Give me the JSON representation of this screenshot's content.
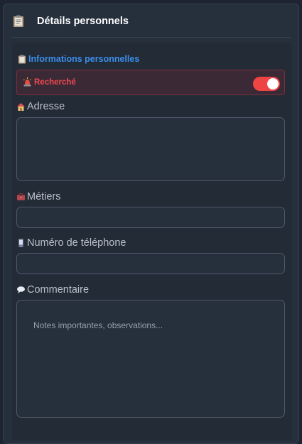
{
  "header": {
    "title": "Détails personnels",
    "icon": "clipboard-icon"
  },
  "section": {
    "title": "Informations personnelles",
    "icon": "clipboard-icon",
    "color": "#3b8eea"
  },
  "wanted": {
    "label": "Recherché",
    "icon": "siren-icon",
    "enabled": true,
    "color": "#ef4444"
  },
  "fields": {
    "address": {
      "label": "Adresse",
      "icon": "house-icon",
      "value": ""
    },
    "jobs": {
      "label": "Métiers",
      "icon": "briefcase-icon",
      "value": ""
    },
    "phone": {
      "label": "Numéro de téléphone",
      "icon": "phone-icon",
      "value": ""
    },
    "comment": {
      "label": "Commentaire",
      "icon": "speech-bubble-icon",
      "value": "",
      "placeholder": "Notes importantes, observations..."
    }
  }
}
